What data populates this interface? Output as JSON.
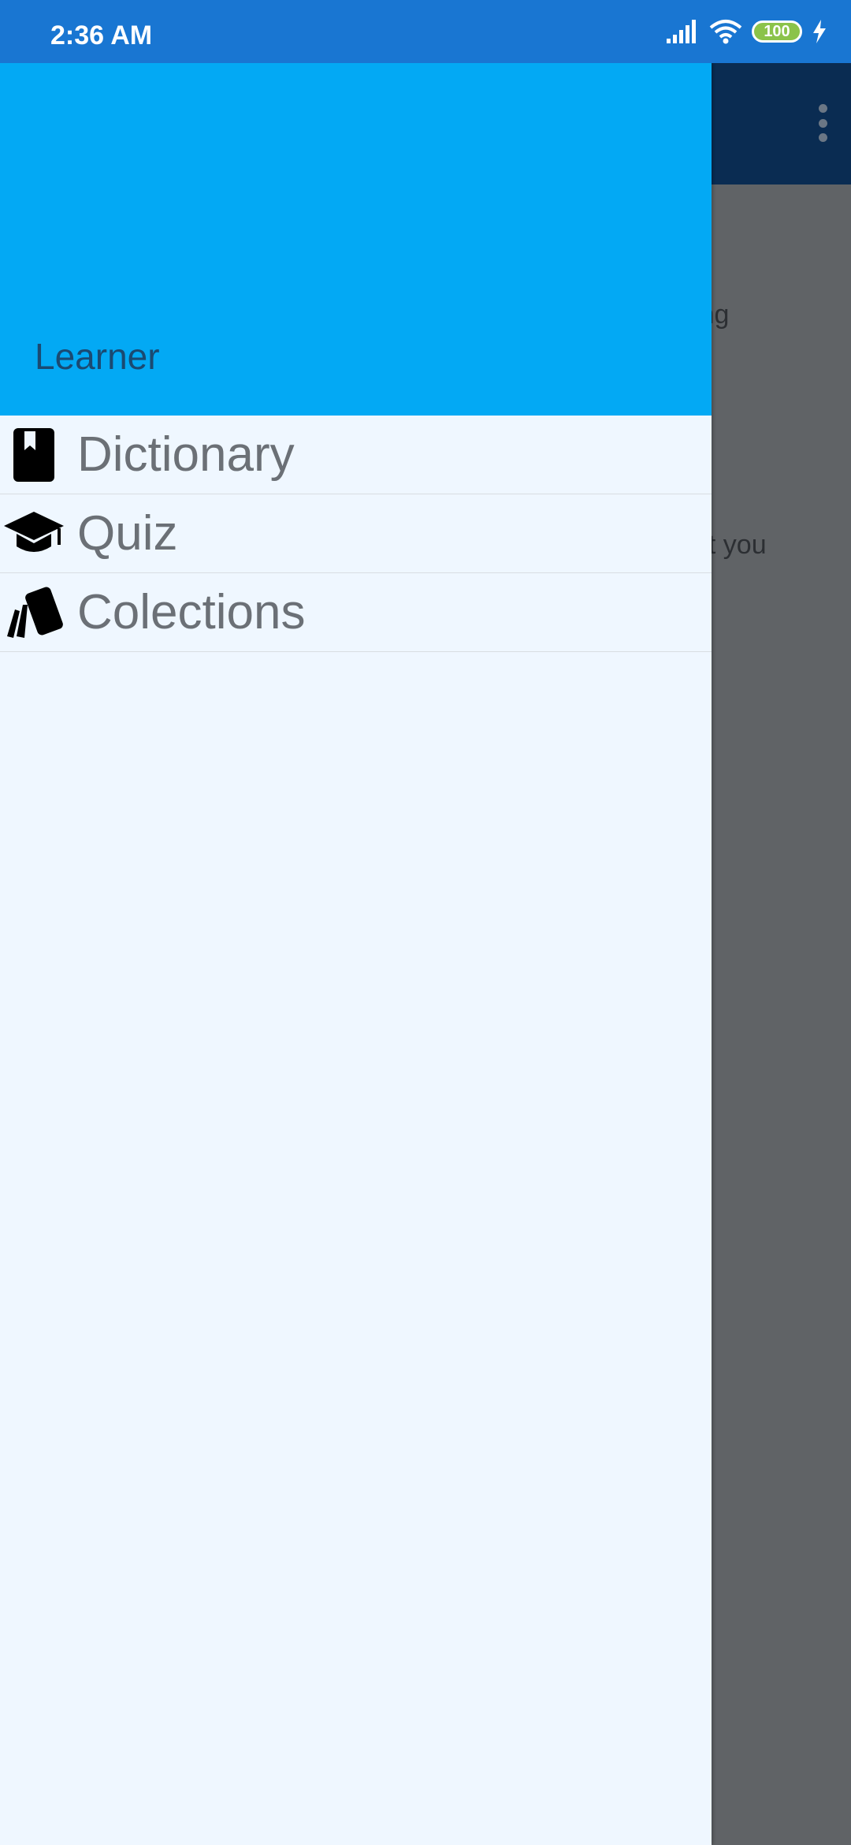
{
  "status_bar": {
    "time": "2:36 AM",
    "battery": "100",
    "icons": [
      "signal-icon",
      "wifi-icon",
      "battery-icon",
      "charging-icon"
    ]
  },
  "background_app": {
    "overflow_menu_icon": "more-vert-icon",
    "text_fragment_1": "ing",
    "text_fragment_2": "et you"
  },
  "drawer": {
    "header_title": "Learner",
    "items": [
      {
        "label": "Dictionary",
        "icon": "book-icon"
      },
      {
        "label": "Quiz",
        "icon": "graduation-cap-icon"
      },
      {
        "label": "Colections",
        "icon": "cards-icon"
      }
    ]
  },
  "colors": {
    "status_bar": "#1976d2",
    "drawer_header": "#03a9f4",
    "drawer_background": "#eff7ff",
    "app_toolbar": "#0a2c52",
    "scrim": "#606366"
  }
}
